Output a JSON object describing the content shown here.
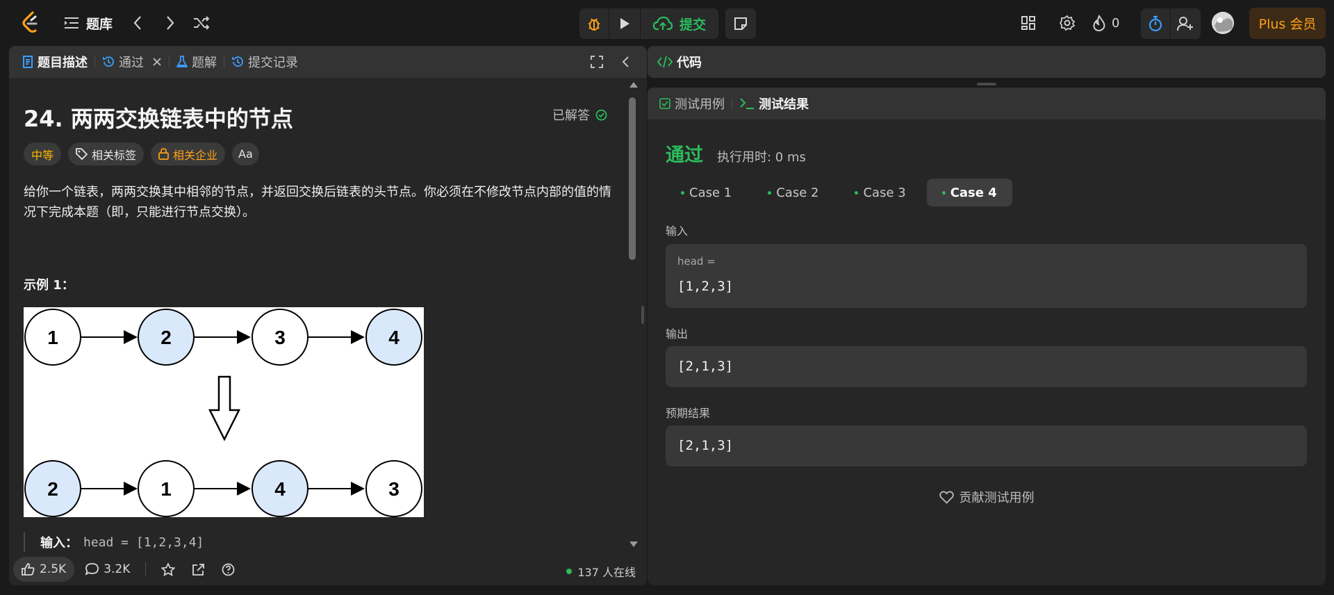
{
  "topbar": {
    "problems_label": "题库",
    "submit_label": "提交",
    "streak_count": "0",
    "plus_label": "Plus 会员"
  },
  "left_panel": {
    "tabs": [
      {
        "label": "题目描述"
      },
      {
        "label": "通过"
      },
      {
        "label": "题解"
      },
      {
        "label": "提交记录"
      }
    ],
    "problem": {
      "title": "24. 两两交换链表中的节点",
      "status": "已解答",
      "badges": {
        "difficulty": "中等",
        "tags": "相关标签",
        "companies": "相关企业",
        "translate": "Aa"
      },
      "description": "给你一个链表，两两交换其中相邻的节点，并返回交换后链表的头节点。你必须在不修改节点内部的值的情况下完成本题（即，只能进行节点交换）。",
      "example_title": "示例 1：",
      "diagram": {
        "top_nodes": [
          "1",
          "2",
          "3",
          "4"
        ],
        "bottom_nodes": [
          "2",
          "1",
          "4",
          "3"
        ],
        "highlight_color": "#dae8fc"
      },
      "example_input_label": "输入：",
      "example_input_value": "head = [1,2,3,4]"
    },
    "footer": {
      "likes": "2.5K",
      "comments": "3.2K",
      "online": "137 人在线"
    }
  },
  "right_panel": {
    "code_tab": "代码",
    "tabs": [
      {
        "label": "测试用例"
      },
      {
        "label": "测试结果"
      }
    ],
    "result": {
      "status": "通过",
      "runtime": "执行用时: 0 ms",
      "cases": [
        "Case 1",
        "Case 2",
        "Case 3",
        "Case 4"
      ],
      "input_label": "输入",
      "input_var": "head =",
      "input_value": "[1,2,3]",
      "output_label": "输出",
      "output_value": "[2,1,3]",
      "expected_label": "预期结果",
      "expected_value": "[2,1,3]",
      "contribute": "贡献测试用例"
    }
  },
  "colors": {
    "accent_green": "#2cbb5d",
    "accent_orange": "#ffa116",
    "medium_yellow": "#ffb800",
    "timer_blue": "#3b9eff"
  }
}
